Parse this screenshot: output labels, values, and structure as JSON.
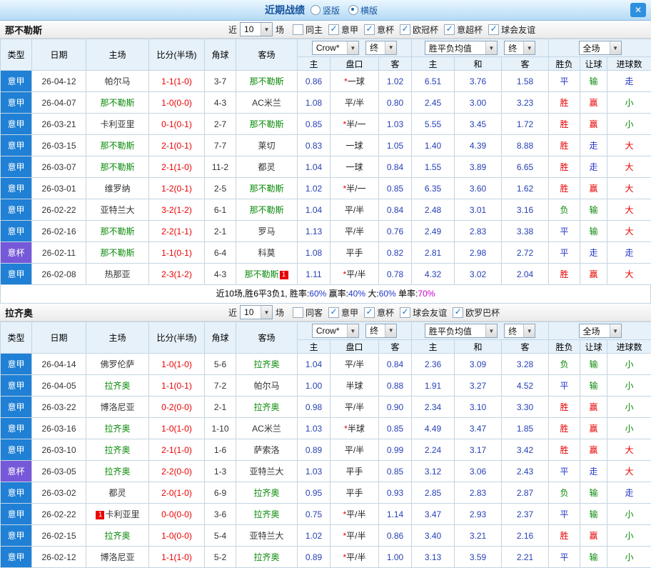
{
  "titlebar": {
    "title": "近期战绩",
    "vertical_label": "竖版",
    "horizontal_label": "横版",
    "selected": "横版"
  },
  "icons": {
    "close": "✕",
    "dropdown": "▼",
    "check": "✓"
  },
  "controls": {
    "near": "近",
    "count": "10",
    "games": "场",
    "bookmaker": "Crow*",
    "final": "终",
    "avg": "胜平负均值",
    "scope": "全场"
  },
  "headers": {
    "type": "类型",
    "date": "日期",
    "home": "主场",
    "score": "比分(半场)",
    "corner": "角球",
    "away": "客场",
    "h": "主",
    "hcp": "盘口",
    "a": "客",
    "eh": "主",
    "ed": "和",
    "ea": "客",
    "res": "胜负",
    "let": "让球",
    "goal": "进球数"
  },
  "colors": {
    "red": "#e80000",
    "blue": "#2438c8",
    "green": "#0a8a0a",
    "odds": "#2741b6",
    "team": "#088a08",
    "title": "#17549e",
    "purple": "#cc00cc"
  },
  "value_colors": {
    "胜": "red",
    "平": "blue",
    "负": "green",
    "赢": "red",
    "走": "blue",
    "输": "green",
    "大": "red",
    "小": "green"
  },
  "type_colors": {
    "意甲": "#1f80d5",
    "意杯": "#7758d8"
  },
  "sections": {
    "napoli": {
      "team": "那不勒斯",
      "filters": [
        {
          "label": "同主",
          "checked": false
        },
        {
          "label": "意甲",
          "checked": true
        },
        {
          "label": "意杯",
          "checked": true
        },
        {
          "label": "欧冠杯",
          "checked": true
        },
        {
          "label": "意超杯",
          "checked": true
        },
        {
          "label": "球会友谊",
          "checked": true
        }
      ],
      "rows": [
        {
          "type": "意甲",
          "date": "26-04-12",
          "home": "帕尔马",
          "home_team": false,
          "home_badge": "",
          "home_badge_before": false,
          "score": "1-1(1-0)",
          "corner": "3-7",
          "away": "那不勒斯",
          "away_team": true,
          "away_badge": "",
          "o1": "0.86",
          "hcp": "*一球",
          "o2": "1.02",
          "e1": "6.51",
          "e2": "3.76",
          "e3": "1.58",
          "res": "平",
          "let": "输",
          "goal": "走"
        },
        {
          "type": "意甲",
          "date": "26-04-07",
          "home": "那不勒斯",
          "home_team": true,
          "home_badge": "",
          "home_badge_before": false,
          "score": "1-0(0-0)",
          "corner": "4-3",
          "away": "AC米兰",
          "away_team": false,
          "away_badge": "",
          "o1": "1.08",
          "hcp": "平/半",
          "o2": "0.80",
          "e1": "2.45",
          "e2": "3.00",
          "e3": "3.23",
          "res": "胜",
          "let": "赢",
          "goal": "小"
        },
        {
          "type": "意甲",
          "date": "26-03-21",
          "home": "卡利亚里",
          "home_team": false,
          "home_badge": "",
          "home_badge_before": false,
          "score": "0-1(0-1)",
          "corner": "2-7",
          "away": "那不勒斯",
          "away_team": true,
          "away_badge": "",
          "o1": "0.85",
          "hcp": "*半/一",
          "o2": "1.03",
          "e1": "5.55",
          "e2": "3.45",
          "e3": "1.72",
          "res": "胜",
          "let": "赢",
          "goal": "小"
        },
        {
          "type": "意甲",
          "date": "26-03-15",
          "home": "那不勒斯",
          "home_team": true,
          "home_badge": "",
          "home_badge_before": false,
          "score": "2-1(0-1)",
          "corner": "7-7",
          "away": "莱切",
          "away_team": false,
          "away_badge": "",
          "o1": "0.83",
          "hcp": "一球",
          "o2": "1.05",
          "e1": "1.40",
          "e2": "4.39",
          "e3": "8.88",
          "res": "胜",
          "let": "走",
          "goal": "大"
        },
        {
          "type": "意甲",
          "date": "26-03-07",
          "home": "那不勒斯",
          "home_team": true,
          "home_badge": "",
          "home_badge_before": false,
          "score": "2-1(1-0)",
          "corner": "11-2",
          "away": "都灵",
          "away_team": false,
          "away_badge": "",
          "o1": "1.04",
          "hcp": "一球",
          "o2": "0.84",
          "e1": "1.55",
          "e2": "3.89",
          "e3": "6.65",
          "res": "胜",
          "let": "走",
          "goal": "大"
        },
        {
          "type": "意甲",
          "date": "26-03-01",
          "home": "维罗纳",
          "home_team": false,
          "home_badge": "",
          "home_badge_before": false,
          "score": "1-2(0-1)",
          "corner": "2-5",
          "away": "那不勒斯",
          "away_team": true,
          "away_badge": "",
          "o1": "1.02",
          "hcp": "*半/一",
          "o2": "0.85",
          "e1": "6.35",
          "e2": "3.60",
          "e3": "1.62",
          "res": "胜",
          "let": "赢",
          "goal": "大"
        },
        {
          "type": "意甲",
          "date": "26-02-22",
          "home": "亚特兰大",
          "home_team": false,
          "home_badge": "",
          "home_badge_before": false,
          "score": "3-2(1-2)",
          "corner": "6-1",
          "away": "那不勒斯",
          "away_team": true,
          "away_badge": "",
          "o1": "1.04",
          "hcp": "平/半",
          "o2": "0.84",
          "e1": "2.48",
          "e2": "3.01",
          "e3": "3.16",
          "res": "负",
          "let": "输",
          "goal": "大"
        },
        {
          "type": "意甲",
          "date": "26-02-16",
          "home": "那不勒斯",
          "home_team": true,
          "home_badge": "",
          "home_badge_before": false,
          "score": "2-2(1-1)",
          "corner": "2-1",
          "away": "罗马",
          "away_team": false,
          "away_badge": "",
          "o1": "1.13",
          "hcp": "平/半",
          "o2": "0.76",
          "e1": "2.49",
          "e2": "2.83",
          "e3": "3.38",
          "res": "平",
          "let": "输",
          "goal": "大"
        },
        {
          "type": "意杯",
          "date": "26-02-11",
          "home": "那不勒斯",
          "home_team": true,
          "home_badge": "",
          "home_badge_before": false,
          "score": "1-1(0-1)",
          "corner": "6-4",
          "away": "科莫",
          "away_team": false,
          "away_badge": "",
          "o1": "1.08",
          "hcp": "平手",
          "o2": "0.82",
          "e1": "2.81",
          "e2": "2.98",
          "e3": "2.72",
          "res": "平",
          "let": "走",
          "goal": "走"
        },
        {
          "type": "意甲",
          "date": "26-02-08",
          "home": "热那亚",
          "home_team": false,
          "home_badge": "",
          "home_badge_before": false,
          "score": "2-3(1-2)",
          "corner": "4-3",
          "away": "那不勒斯",
          "away_team": true,
          "away_badge": "1",
          "o1": "1.11",
          "hcp": "*平/半",
          "o2": "0.78",
          "e1": "4.32",
          "e2": "3.02",
          "e3": "2.04",
          "res": "胜",
          "let": "赢",
          "goal": "大"
        }
      ],
      "summary": [
        {
          "text": "近10场,胜6平3负1, 胜率:",
          "color": "#000000"
        },
        {
          "text": "60%",
          "color": "#2438c8"
        },
        {
          "text": " 赢率:",
          "color": "#000000"
        },
        {
          "text": "40%",
          "color": "#2438c8"
        },
        {
          "text": " 大:",
          "color": "#000000"
        },
        {
          "text": "60%",
          "color": "#2438c8"
        },
        {
          "text": " 单率:",
          "color": "#000000"
        },
        {
          "text": "70%",
          "color": "#cc00cc"
        }
      ]
    },
    "lazio": {
      "team": "拉齐奥",
      "filters": [
        {
          "label": "同客",
          "checked": false
        },
        {
          "label": "意甲",
          "checked": true
        },
        {
          "label": "意杯",
          "checked": true
        },
        {
          "label": "球会友谊",
          "checked": true
        },
        {
          "label": "欧罗巴杯",
          "checked": true
        }
      ],
      "rows": [
        {
          "type": "意甲",
          "date": "26-04-14",
          "home": "佛罗伦萨",
          "home_team": false,
          "home_badge": "",
          "home_badge_before": false,
          "score": "1-0(1-0)",
          "corner": "5-6",
          "away": "拉齐奥",
          "away_team": true,
          "away_badge": "",
          "o1": "1.04",
          "hcp": "平/半",
          "o2": "0.84",
          "e1": "2.36",
          "e2": "3.09",
          "e3": "3.28",
          "res": "负",
          "let": "输",
          "goal": "小"
        },
        {
          "type": "意甲",
          "date": "26-04-05",
          "home": "拉齐奥",
          "home_team": true,
          "home_badge": "",
          "home_badge_before": false,
          "score": "1-1(0-1)",
          "corner": "7-2",
          "away": "帕尔马",
          "away_team": false,
          "away_badge": "",
          "o1": "1.00",
          "hcp": "半球",
          "o2": "0.88",
          "e1": "1.91",
          "e2": "3.27",
          "e3": "4.52",
          "res": "平",
          "let": "输",
          "goal": "小"
        },
        {
          "type": "意甲",
          "date": "26-03-22",
          "home": "博洛尼亚",
          "home_team": false,
          "home_badge": "",
          "home_badge_before": false,
          "score": "0-2(0-0)",
          "corner": "2-1",
          "away": "拉齐奥",
          "away_team": true,
          "away_badge": "",
          "o1": "0.98",
          "hcp": "平/半",
          "o2": "0.90",
          "e1": "2.34",
          "e2": "3.10",
          "e3": "3.30",
          "res": "胜",
          "let": "赢",
          "goal": "小"
        },
        {
          "type": "意甲",
          "date": "26-03-16",
          "home": "拉齐奥",
          "home_team": true,
          "home_badge": "",
          "home_badge_before": false,
          "score": "1-0(1-0)",
          "corner": "1-10",
          "away": "AC米兰",
          "away_team": false,
          "away_badge": "",
          "o1": "1.03",
          "hcp": "*半球",
          "o2": "0.85",
          "e1": "4.49",
          "e2": "3.47",
          "e3": "1.85",
          "res": "胜",
          "let": "赢",
          "goal": "小"
        },
        {
          "type": "意甲",
          "date": "26-03-10",
          "home": "拉齐奥",
          "home_team": true,
          "home_badge": "",
          "home_badge_before": false,
          "score": "2-1(1-0)",
          "corner": "1-6",
          "away": "萨索洛",
          "away_team": false,
          "away_badge": "",
          "o1": "0.89",
          "hcp": "平/半",
          "o2": "0.99",
          "e1": "2.24",
          "e2": "3.17",
          "e3": "3.42",
          "res": "胜",
          "let": "赢",
          "goal": "大"
        },
        {
          "type": "意杯",
          "date": "26-03-05",
          "home": "拉齐奥",
          "home_team": true,
          "home_badge": "",
          "home_badge_before": false,
          "score": "2-2(0-0)",
          "corner": "1-3",
          "away": "亚特兰大",
          "away_team": false,
          "away_badge": "",
          "o1": "1.03",
          "hcp": "平手",
          "o2": "0.85",
          "e1": "3.12",
          "e2": "3.06",
          "e3": "2.43",
          "res": "平",
          "let": "走",
          "goal": "大"
        },
        {
          "type": "意甲",
          "date": "26-03-02",
          "home": "都灵",
          "home_team": false,
          "home_badge": "",
          "home_badge_before": false,
          "score": "2-0(1-0)",
          "corner": "6-9",
          "away": "拉齐奥",
          "away_team": true,
          "away_badge": "",
          "o1": "0.95",
          "hcp": "平手",
          "o2": "0.93",
          "e1": "2.85",
          "e2": "2.83",
          "e3": "2.87",
          "res": "负",
          "let": "输",
          "goal": "走"
        },
        {
          "type": "意甲",
          "date": "26-02-22",
          "home": "卡利亚里",
          "home_team": false,
          "home_badge": "1",
          "home_badge_before": true,
          "score": "0-0(0-0)",
          "corner": "3-6",
          "away": "拉齐奥",
          "away_team": true,
          "away_badge": "",
          "o1": "0.75",
          "hcp": "*平/半",
          "o2": "1.14",
          "e1": "3.47",
          "e2": "2.93",
          "e3": "2.37",
          "res": "平",
          "let": "输",
          "goal": "小"
        },
        {
          "type": "意甲",
          "date": "26-02-15",
          "home": "拉齐奥",
          "home_team": true,
          "home_badge": "",
          "home_badge_before": false,
          "score": "1-0(0-0)",
          "corner": "5-4",
          "away": "亚特兰大",
          "away_team": false,
          "away_badge": "",
          "o1": "1.02",
          "hcp": "*平/半",
          "o2": "0.86",
          "e1": "3.40",
          "e2": "3.21",
          "e3": "2.16",
          "res": "胜",
          "let": "赢",
          "goal": "小"
        },
        {
          "type": "意甲",
          "date": "26-02-12",
          "home": "博洛尼亚",
          "home_team": false,
          "home_badge": "",
          "home_badge_before": false,
          "score": "1-1(1-0)",
          "corner": "5-2",
          "away": "拉齐奥",
          "away_team": true,
          "away_badge": "",
          "o1": "0.89",
          "hcp": "*平/半",
          "o2": "1.00",
          "e1": "3.13",
          "e2": "3.59",
          "e3": "2.21",
          "res": "平",
          "let": "输",
          "goal": "小"
        }
      ],
      "summary": []
    }
  }
}
